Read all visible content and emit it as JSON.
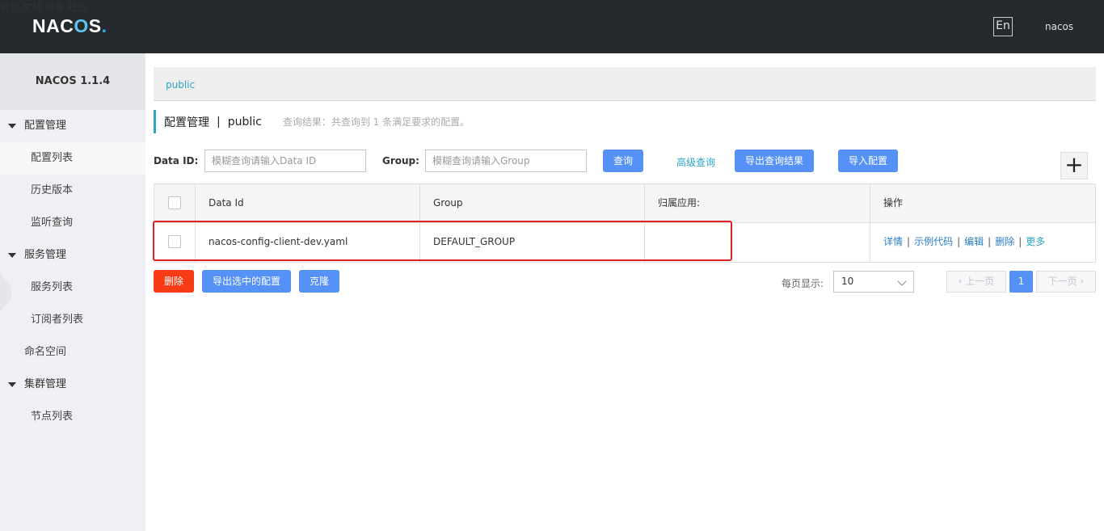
{
  "header": {
    "logo_text": "NAC",
    "logo_o": "O",
    "logo_rest": "S",
    "logo_dot": ".",
    "nav": [
      "首页",
      "文档",
      "博客",
      "社区"
    ],
    "lang": "En",
    "user": "nacos"
  },
  "sidebar": {
    "version": "NACOS 1.1.4",
    "config_group": "配置管理",
    "config_list": "配置列表",
    "history": "历史版本",
    "listener": "监听查询",
    "service_group": "服务管理",
    "service_list": "服务列表",
    "subscriber_list": "订阅者列表",
    "namespace": "命名空间",
    "cluster_group": "集群管理",
    "node_list": "节点列表"
  },
  "breadcrumb": {
    "namespace": "public"
  },
  "title": {
    "main": "配置管理",
    "sep": "|",
    "ns": "public",
    "hint": "查询结果：共查询到 1 条满足要求的配置。"
  },
  "search": {
    "dataid_label": "Data ID:",
    "dataid_placeholder": "模糊查询请输入Data ID",
    "group_label": "Group:",
    "group_placeholder": "模糊查询请输入Group",
    "query_btn": "查询",
    "advanced": "高级查询",
    "export_result_btn": "导出查询结果",
    "import_btn": "导入配置",
    "add_btn": "+"
  },
  "table": {
    "headers": [
      "Data Id",
      "Group",
      "归属应用:",
      "操作"
    ],
    "rows": [
      {
        "data_id": "nacos-config-client-dev.yaml",
        "group": "DEFAULT_GROUP",
        "app": "",
        "ops": [
          "详情",
          "示例代码",
          "编辑",
          "删除",
          "更多"
        ]
      }
    ]
  },
  "actions": {
    "delete_btn": "删除",
    "export_selected_btn": "导出选中的配置",
    "clone_btn": "克隆"
  },
  "pagination": {
    "per_page_label": "每页显示:",
    "page_size": "10",
    "prev": "上一页",
    "current": "1",
    "next": "下一页"
  },
  "colors": {
    "topbar": "#252a2f",
    "accent": "#2ba6c4",
    "primary": "#5591f6",
    "danger": "#f73b15",
    "highlight": "#e02020"
  }
}
